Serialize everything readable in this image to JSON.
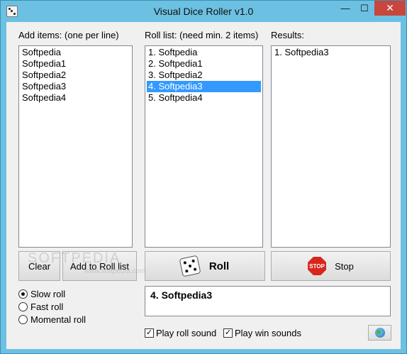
{
  "window": {
    "title": "Visual Dice Roller v1.0",
    "min_glyph": "—",
    "max_glyph": "☐",
    "close_glyph": "✕"
  },
  "labels": {
    "add_items": "Add items: (one per line)",
    "roll_list": "Roll list: (need min. 2 items)",
    "results": "Results:"
  },
  "add_items": [
    "Softpedia",
    "Softpedia1",
    "Softpedia2",
    "Softpedia3",
    "Softpedia4"
  ],
  "roll_list": {
    "items": [
      "1. Softpedia",
      "2. Softpedia1",
      "3. Softpedia2",
      "4. Softpedia3",
      "5. Softpedia4"
    ],
    "selected_index": 3
  },
  "results": [
    "1. Softpedia3"
  ],
  "buttons": {
    "clear": "Clear",
    "add_to_roll": "Add to Roll list",
    "roll": "Roll",
    "stop": "Stop",
    "stop_sign": "STOP"
  },
  "roll_modes": {
    "options": [
      "Slow roll",
      "Fast roll",
      "Momental roll"
    ],
    "selected": "Slow roll"
  },
  "current_result": "4. Softpedia3",
  "options": {
    "play_roll_sound": {
      "label": "Play roll sound",
      "checked": true
    },
    "play_win_sounds": {
      "label": "Play win sounds",
      "checked": true
    }
  },
  "watermark": {
    "main": "SOFTPEDIA",
    "sub": "www.softpedia.com"
  },
  "colors": {
    "title_bar": "#6cc0e2",
    "close_button": "#c9463d",
    "selection": "#3399ff"
  },
  "icons": {
    "app": "dice-icon",
    "roll": "dice-icon",
    "stop": "stop-sign-icon",
    "web": "globe-icon"
  }
}
